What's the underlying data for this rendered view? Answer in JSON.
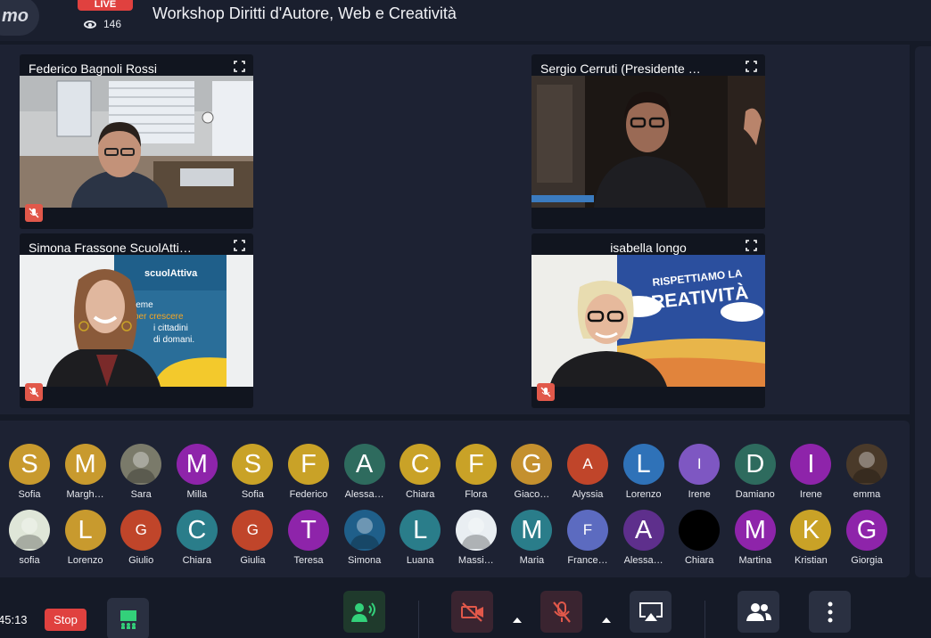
{
  "app": {
    "logo_text": "mo"
  },
  "header": {
    "live_label": "LIVE",
    "viewer_count": "146",
    "title": "Workshop Diritti d'Autore, Web e Creatività"
  },
  "tiles": [
    {
      "name": "Federico Bagnoli Rossi",
      "muted": true
    },
    {
      "name": "Sergio Cerruti (Presidente …",
      "muted": false
    },
    {
      "name": "Simona Frassone ScuolAtti…",
      "muted": true
    },
    {
      "name": "isabella longo",
      "muted": true
    }
  ],
  "banners": {
    "scuolattiva_logo": "scuolAttiva",
    "scuolattiva_line1": "ieme",
    "scuolattiva_line2": "per crescere",
    "scuolattiva_line3": "i cittadini",
    "scuolattiva_line4": "di domani.",
    "creativita_line1": "RISPETTIAMO LA",
    "creativita_line2": "CREATIVITÀ"
  },
  "participants": {
    "row1": [
      {
        "initial": "S",
        "name": "Sofia",
        "color": "#c89a2e"
      },
      {
        "initial": "M",
        "name": "Margh…",
        "color": "#c89a2e"
      },
      {
        "initial": "",
        "name": "Sara",
        "color": "#7a7a6a",
        "photo": true
      },
      {
        "initial": "M",
        "name": "Milla",
        "color": "#8e24aa"
      },
      {
        "initial": "S",
        "name": "Sofia",
        "color": "#c9a227"
      },
      {
        "initial": "F",
        "name": "Federico",
        "color": "#c9a227"
      },
      {
        "initial": "A",
        "name": "Alessa…",
        "color": "#2e6b5e"
      },
      {
        "initial": "C",
        "name": "Chiara",
        "color": "#c9a227"
      },
      {
        "initial": "F",
        "name": "Flora",
        "color": "#c9a227"
      },
      {
        "initial": "G",
        "name": "Giaco…",
        "color": "#c4902e"
      },
      {
        "initial": "A",
        "name": "Alyssia",
        "color": "#c0452a",
        "small": true
      },
      {
        "initial": "L",
        "name": "Lorenzo",
        "color": "#2f72b8"
      },
      {
        "initial": "I",
        "name": "Irene",
        "color": "#7e57c2",
        "small": true
      },
      {
        "initial": "D",
        "name": "Damiano",
        "color": "#2e6b5e"
      },
      {
        "initial": "I",
        "name": "Irene",
        "color": "#8e24aa"
      },
      {
        "initial": "",
        "name": "emma",
        "color": "#4a3a2a",
        "photo": true
      }
    ],
    "row2": [
      {
        "initial": "",
        "name": "sofia",
        "color": "#dfe6d8",
        "photo": true
      },
      {
        "initial": "L",
        "name": "Lorenzo",
        "color": "#c89a2e"
      },
      {
        "initial": "G",
        "name": "Giulio",
        "color": "#c0452a",
        "small": true
      },
      {
        "initial": "C",
        "name": "Chiara",
        "color": "#2a7d8a"
      },
      {
        "initial": "G",
        "name": "Giulia",
        "color": "#c0452a",
        "small": true
      },
      {
        "initial": "T",
        "name": "Teresa",
        "color": "#8e24aa"
      },
      {
        "initial": "",
        "name": "Simona",
        "color": "#1f5f8a",
        "photo": true
      },
      {
        "initial": "L",
        "name": "Luana",
        "color": "#2a7d8a"
      },
      {
        "initial": "",
        "name": "Massi…",
        "color": "#e9eef2",
        "photo": true
      },
      {
        "initial": "M",
        "name": "Maria",
        "color": "#2a7d8a"
      },
      {
        "initial": "F",
        "name": "France…",
        "color": "#5c6bc0",
        "small": true
      },
      {
        "initial": "A",
        "name": "Alessa…",
        "color": "#5e2f8c"
      },
      {
        "initial": "",
        "name": "Chiara",
        "color": "#000000"
      },
      {
        "initial": "M",
        "name": "Martina",
        "color": "#8e24aa"
      },
      {
        "initial": "K",
        "name": "Kristian",
        "color": "#c9a227"
      },
      {
        "initial": "G",
        "name": "Giorgia",
        "color": "#8e24aa"
      }
    ]
  },
  "controls": {
    "timer": "45:13",
    "stop_label": "Stop"
  },
  "colors": {
    "live": "#e0413f",
    "mic_off": "#e1584a",
    "speaker_on": "#33d17a"
  }
}
